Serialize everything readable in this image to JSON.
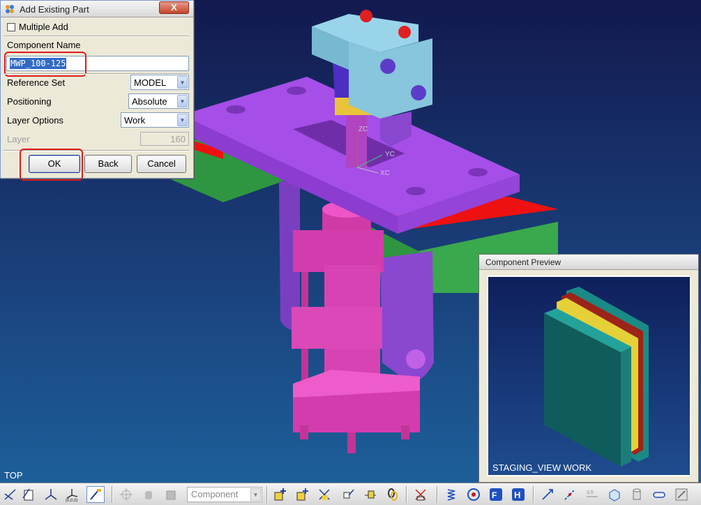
{
  "dialog": {
    "title": "Add Existing Part",
    "close_label": "X",
    "multiple_add_label": "Multiple Add",
    "multiple_add_checked": false,
    "component_name_label": "Component Name",
    "component_name_value": "MWP_100-125",
    "reference_set_label": "Reference Set",
    "reference_set_value": "MODEL",
    "positioning_label": "Positioning",
    "positioning_value": "Absolute",
    "layer_options_label": "Layer Options",
    "layer_options_value": "Work",
    "layer_label": "Layer",
    "layer_value": "160",
    "ok_label": "OK",
    "back_label": "Back",
    "cancel_label": "Cancel"
  },
  "viewport": {
    "view_name": "TOP",
    "axis_labels": {
      "z": "ZC",
      "y": "YC",
      "x": "XC"
    }
  },
  "preview": {
    "title": "Component Preview",
    "view_label": "STAGING_VIEW WORK"
  },
  "toolbar": {
    "filter_combo_value": "Component",
    "icon_names": [
      "sketch-icon",
      "drawing-icon",
      "datum-csys-icon",
      "wcs-origin-icon",
      "brush-icon",
      "snap-point-icon",
      "hand-icon",
      "part-icon",
      "add-component-icon",
      "new-component-icon",
      "mate-icon",
      "reposition-icon",
      "constraints-icon",
      "chain-icon",
      "explode-icon",
      "spring-icon",
      "circle-icon",
      "force-icon",
      "h-icon",
      "line-arrow-icon",
      "dashed-line-icon",
      "dimension-icon",
      "cube-icon",
      "cylinder-icon",
      "slot-icon",
      "settings-icon"
    ]
  },
  "colors": {
    "plate_purple": "#a64ee8",
    "block_green": "#2e9640",
    "block_red": "#f01010",
    "clamp_pink": "#e23bb7",
    "head_lightblue": "#87c6dd",
    "nut_yellow": "#e9c43a",
    "highlight_red": "#e01a1a"
  }
}
